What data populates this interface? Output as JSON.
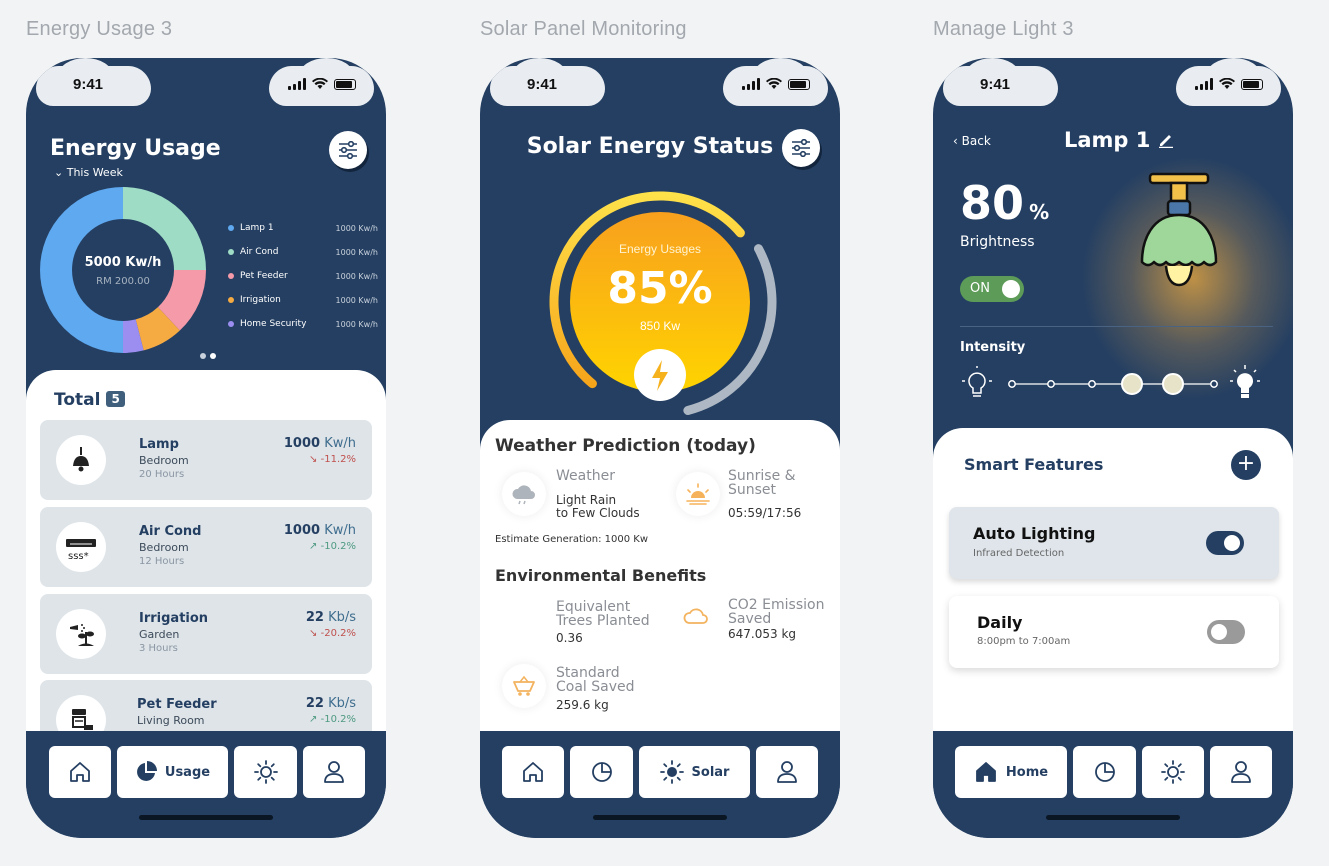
{
  "frames": {
    "energy_usage": "Energy Usage 3",
    "solar": "Solar Panel Monitoring",
    "manage_light": "Manage Light 3"
  },
  "status_bar": {
    "time": "9:41"
  },
  "phone1": {
    "title": "Energy Usage",
    "period": "This Week",
    "donut": {
      "total": "5000 Kw/h",
      "cost": "RM 200.00",
      "segments": [
        {
          "name": "Lamp 1",
          "value": "1000 Kw/h",
          "color": "#5fa9f0",
          "share": 0.5
        },
        {
          "name": "Air Cond",
          "value": "1000 Kw/h",
          "color": "#9fdcc6",
          "share": 0.25
        },
        {
          "name": "Pet Feeder",
          "value": "1000 Kw/h",
          "color": "#f49aa8",
          "share": 0.13
        },
        {
          "name": "Irrigation",
          "value": "1000 Kw/h",
          "color": "#f6aa42",
          "share": 0.08
        },
        {
          "name": "Home Security",
          "value": "1000 Kw/h",
          "color": "#9b8ef0",
          "share": 0.04
        }
      ]
    },
    "total_label": "Total",
    "total_count": "5",
    "devices": [
      {
        "name": "Lamp",
        "room": "Bedroom",
        "hours": "20 Hours",
        "value": "1000",
        "unit": "Kw/h",
        "change": "-11.2%",
        "icon": "pendant-lamp-icon"
      },
      {
        "name": "Air Cond",
        "room": "Bedroom",
        "hours": "12 Hours",
        "value": "1000",
        "unit": "Kw/h",
        "change": "-10.2%",
        "icon": "air-conditioner-icon"
      },
      {
        "name": "Irrigation",
        "room": "Garden",
        "hours": "3 Hours",
        "value": "22",
        "unit": "Kb/s",
        "change": "-20.2%",
        "icon": "sprinkler-icon"
      },
      {
        "name": "Pet Feeder",
        "room": "Living Room",
        "hours": "",
        "value": "22",
        "unit": "Kb/s",
        "change": "-10.2%",
        "icon": "pet-feeder-icon"
      }
    ],
    "nav": {
      "usage": "Usage"
    }
  },
  "phone2": {
    "title": "Solar Energy Status",
    "gauge": {
      "label": "Energy Usages",
      "percent": "85%",
      "value": "850 Kw",
      "fill": 0.85
    },
    "weather_title": "Weather Prediction (today)",
    "weather_label": "Weather",
    "weather_line1": "Light Rain",
    "weather_line2": "to Few Clouds",
    "sun_label1": "Sunrise &",
    "sun_label2": "Sunset",
    "sun_value": "05:59/17:56",
    "estimate": "Estimate Generation: 1000 Kw",
    "env_title": "Environmental Benefits",
    "trees_label1": "Equivalent",
    "trees_label2": "Trees Planted",
    "trees_value": "0.36",
    "co2_label1": "CO2 Emission",
    "co2_label2": "Saved",
    "co2_value": "647.053 kg",
    "coal_label1": "Standard",
    "coal_label2": "Coal Saved",
    "coal_value": "259.6 kg",
    "nav": {
      "solar": "Solar"
    }
  },
  "phone3": {
    "back": "Back",
    "title": "Lamp 1",
    "brightness_value": "80",
    "brightness_unit": "%",
    "brightness_label": "Brightness",
    "power": "ON",
    "intensity_label": "Intensity",
    "intensity_level": 0.8,
    "smart_title": "Smart Features",
    "features": [
      {
        "name": "Auto Lighting",
        "sub": "Infrared Detection",
        "on": true
      },
      {
        "name": "Daily",
        "sub": "8:00pm to 7:00am",
        "on": false
      }
    ],
    "nav": {
      "home": "Home"
    }
  }
}
